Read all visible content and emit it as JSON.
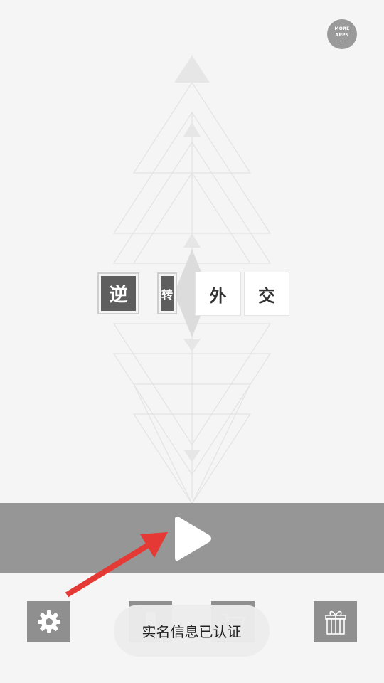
{
  "more_apps": {
    "line1": "MORE",
    "line2": "APPS",
    "line3": "..."
  },
  "title": {
    "chars": [
      "逆",
      "转",
      "外",
      "交"
    ]
  },
  "toast": {
    "text": "实名信息已认证"
  },
  "icons": {
    "play": "play-icon",
    "settings": "gear-icon",
    "phone": "phone-icon",
    "shop": "cart-icon",
    "gift": "gift-icon",
    "annotation": "red-arrow-icon"
  },
  "colors": {
    "background": "#f5f5f5",
    "band": "#969696",
    "button": "#8f8f8f",
    "tile_dark": "#5e5e5e",
    "annotation_arrow": "#e53935"
  }
}
